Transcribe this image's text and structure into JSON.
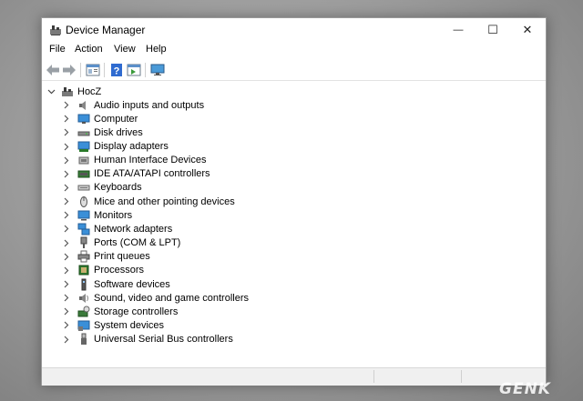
{
  "window": {
    "title": "Device Manager",
    "icon": "device-manager-icon",
    "controls": {
      "minimize": "—",
      "maximize": "☐",
      "close": "✕"
    }
  },
  "menu": [
    "File",
    "Action",
    "View",
    "Help"
  ],
  "toolbar": {
    "buttons": [
      "back-arrow-icon",
      "forward-arrow-icon",
      "properties-icon",
      "help-icon",
      "run-icon",
      "scan-hardware-icon"
    ]
  },
  "tree": {
    "root": {
      "label": "HocZ",
      "expanded": true,
      "icon": "computer-root-icon"
    },
    "items": [
      {
        "label": "Audio inputs and outputs",
        "icon": "speaker-icon"
      },
      {
        "label": "Computer",
        "icon": "computer-icon"
      },
      {
        "label": "Disk drives",
        "icon": "disk-drive-icon"
      },
      {
        "label": "Display adapters",
        "icon": "display-adapter-icon"
      },
      {
        "label": "Human Interface Devices",
        "icon": "hid-icon"
      },
      {
        "label": "IDE ATA/ATAPI controllers",
        "icon": "ide-controller-icon"
      },
      {
        "label": "Keyboards",
        "icon": "keyboard-icon"
      },
      {
        "label": "Mice and other pointing devices",
        "icon": "mouse-icon"
      },
      {
        "label": "Monitors",
        "icon": "monitor-icon"
      },
      {
        "label": "Network adapters",
        "icon": "network-adapter-icon"
      },
      {
        "label": "Ports (COM & LPT)",
        "icon": "port-icon"
      },
      {
        "label": "Print queues",
        "icon": "printer-icon"
      },
      {
        "label": "Processors",
        "icon": "processor-icon"
      },
      {
        "label": "Software devices",
        "icon": "software-device-icon"
      },
      {
        "label": "Sound, video and game controllers",
        "icon": "sound-icon"
      },
      {
        "label": "Storage controllers",
        "icon": "storage-controller-icon"
      },
      {
        "label": "System devices",
        "icon": "system-device-icon"
      },
      {
        "label": "Universal Serial Bus controllers",
        "icon": "usb-icon"
      }
    ]
  },
  "watermark": "GENK"
}
